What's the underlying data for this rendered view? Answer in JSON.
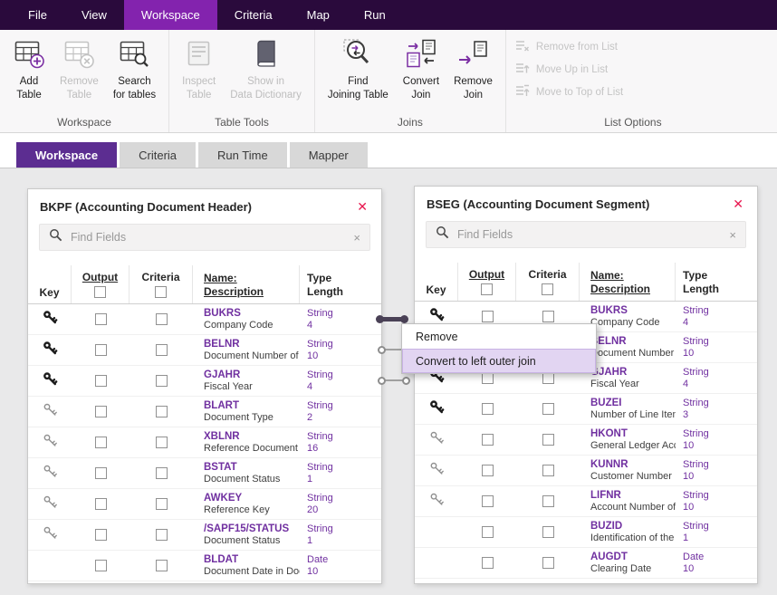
{
  "colors": {
    "topbar_bg": "#2a0a3c",
    "menu_active_bg": "#8323ae",
    "tab_active_bg": "#5c2d91",
    "field_name_purple": "#7030a0",
    "close_x_red": "#e8174f",
    "context_highlight_bg": "#e2d5f2"
  },
  "menubar": {
    "items": [
      {
        "label": "File",
        "active": false
      },
      {
        "label": "View",
        "active": false
      },
      {
        "label": "Workspace",
        "active": true
      },
      {
        "label": "Criteria",
        "active": false
      },
      {
        "label": "Map",
        "active": false
      },
      {
        "label": "Run",
        "active": false
      }
    ]
  },
  "ribbon": {
    "groups": [
      {
        "label": "Workspace",
        "type": "large",
        "buttons": [
          {
            "label": "Add\nTable",
            "icon": "add-table-icon",
            "enabled": true
          },
          {
            "label": "Remove\nTable",
            "icon": "remove-table-icon",
            "enabled": false
          },
          {
            "label": "Search\nfor tables",
            "icon": "search-tables-icon",
            "enabled": true
          }
        ]
      },
      {
        "label": "Table Tools",
        "type": "large",
        "buttons": [
          {
            "label": "Inspect\nTable",
            "icon": "inspect-table-icon",
            "enabled": false
          },
          {
            "label": "Show in\nData Dictionary",
            "icon": "data-dictionary-icon",
            "enabled": false
          }
        ]
      },
      {
        "label": "Joins",
        "type": "large",
        "buttons": [
          {
            "label": "Find\nJoining Table",
            "icon": "find-joining-table-icon",
            "enabled": true
          },
          {
            "label": "Convert\nJoin",
            "icon": "convert-join-icon",
            "enabled": true
          },
          {
            "label": "Remove\nJoin",
            "icon": "remove-join-icon",
            "enabled": true
          }
        ]
      },
      {
        "label": "List Options",
        "type": "small",
        "buttons": [
          {
            "label": "Remove from List",
            "icon": "remove-from-list-icon",
            "enabled": false
          },
          {
            "label": "Move Up in List",
            "icon": "move-up-list-icon",
            "enabled": false
          },
          {
            "label": "Move to Top of List",
            "icon": "move-top-list-icon",
            "enabled": false
          }
        ]
      }
    ]
  },
  "tabs": [
    {
      "label": "Workspace",
      "active": true
    },
    {
      "label": "Criteria",
      "active": false
    },
    {
      "label": "Run Time",
      "active": false
    },
    {
      "label": "Mapper",
      "active": false
    }
  ],
  "table_columns": {
    "key": "Key",
    "output": "Output",
    "criteria": "Criteria",
    "name": "Name:",
    "description": "Description",
    "type": "Type",
    "length": "Length"
  },
  "panels": [
    {
      "id": "bkpf",
      "title": "BKPF (Accounting Document Header)",
      "search_placeholder": "Find Fields",
      "rows": [
        {
          "key": "solid",
          "name": "BUKRS",
          "description": "Company Code",
          "type": "String",
          "length": "4"
        },
        {
          "key": "solid",
          "name": "BELNR",
          "description": "Document Number of a",
          "type": "String",
          "length": "10"
        },
        {
          "key": "solid",
          "name": "GJAHR",
          "description": "Fiscal Year",
          "type": "String",
          "length": "4"
        },
        {
          "key": "outline",
          "name": "BLART",
          "description": "Document Type",
          "type": "String",
          "length": "2"
        },
        {
          "key": "outline",
          "name": "XBLNR",
          "description": "Reference Document N",
          "type": "String",
          "length": "16"
        },
        {
          "key": "outline",
          "name": "BSTAT",
          "description": "Document Status",
          "type": "String",
          "length": "1"
        },
        {
          "key": "outline",
          "name": "AWKEY",
          "description": "Reference Key",
          "type": "String",
          "length": "20"
        },
        {
          "key": "outline",
          "name": "/SAPF15/STATUS",
          "description": "Document Status",
          "type": "String",
          "length": "1"
        },
        {
          "key": "none",
          "name": "BLDAT",
          "description": "Document Date in Docu",
          "type": "Date",
          "length": "10"
        }
      ]
    },
    {
      "id": "bseg",
      "title": "BSEG (Accounting Document Segment)",
      "search_placeholder": "Find Fields",
      "rows": [
        {
          "key": "solid",
          "name": "BUKRS",
          "description": "Company Code",
          "type": "String",
          "length": "4"
        },
        {
          "key": "solid",
          "name": "BELNR",
          "description": "Document Number of a",
          "type": "String",
          "length": "10"
        },
        {
          "key": "solid",
          "name": "GJAHR",
          "description": "Fiscal Year",
          "type": "String",
          "length": "4"
        },
        {
          "key": "solid",
          "name": "BUZEI",
          "description": "Number of Line Item W",
          "type": "String",
          "length": "3"
        },
        {
          "key": "outline",
          "name": "HKONT",
          "description": "General Ledger Accoun",
          "type": "String",
          "length": "10"
        },
        {
          "key": "outline",
          "name": "KUNNR",
          "description": "Customer Number",
          "type": "String",
          "length": "10"
        },
        {
          "key": "outline",
          "name": "LIFNR",
          "description": "Account Number of Sup",
          "type": "String",
          "length": "10"
        },
        {
          "key": "none",
          "name": "BUZID",
          "description": "Identification of the Lin",
          "type": "String",
          "length": "1"
        },
        {
          "key": "none",
          "name": "AUGDT",
          "description": "Clearing Date",
          "type": "Date",
          "length": "10"
        }
      ]
    }
  ],
  "context_menu": {
    "items": [
      {
        "label": "Remove",
        "highlighted": false
      },
      {
        "label": "Convert to left outer join",
        "highlighted": true
      }
    ]
  },
  "icons_text": {
    "close_x": "✕",
    "search_clear": "×"
  }
}
